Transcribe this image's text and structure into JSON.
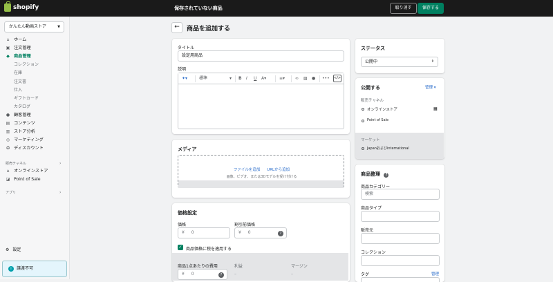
{
  "topbar": {
    "logo": "shopify",
    "title": "保存されていない商品",
    "discard": "取り消す",
    "save": "保存する"
  },
  "sidebar": {
    "store": "かんたん動画ストア",
    "items": [
      {
        "label": "ホーム",
        "icon": "home-icon",
        "glyph": "⌂"
      },
      {
        "label": "注文管理",
        "icon": "orders-icon",
        "glyph": "▣"
      },
      {
        "label": "商品管理",
        "icon": "tag-icon",
        "glyph": "◆",
        "active": true
      },
      {
        "label": "コレクション",
        "sub": true
      },
      {
        "label": "在庫",
        "sub": true
      },
      {
        "label": "注文書",
        "sub": true
      },
      {
        "label": "仕入",
        "sub": true
      },
      {
        "label": "ギフトカード",
        "sub": true
      },
      {
        "label": "カタログ",
        "sub": true
      },
      {
        "label": "顧客管理",
        "icon": "customers-icon",
        "glyph": "●"
      },
      {
        "label": "コンテンツ",
        "icon": "content-icon",
        "glyph": "▤"
      },
      {
        "label": "ストア分析",
        "icon": "analytics-icon",
        "glyph": "▥"
      },
      {
        "label": "マーケティング",
        "icon": "marketing-icon",
        "glyph": "◎"
      },
      {
        "label": "ディスカウント",
        "icon": "discount-icon",
        "glyph": "✪"
      }
    ],
    "channels_header": "販売チャネル",
    "channels": [
      {
        "label": "オンラインストア",
        "icon": "store-icon",
        "glyph": "⌂"
      },
      {
        "label": "Point of Sale",
        "icon": "pos-icon",
        "glyph": "◪"
      }
    ],
    "apps_header": "アプリ",
    "settings": "設定",
    "notice": "譲渡不可"
  },
  "page": {
    "title": "商品を追加する"
  },
  "product_card": {
    "title_label": "タイトル",
    "title_value": "設定用商品",
    "desc_label": "説明",
    "toolbar": {
      "format": "標準",
      "bold": "B",
      "italic": "I",
      "underline": "U",
      "color": "A",
      "align": "≡",
      "more": "•••",
      "code": "</>"
    }
  },
  "media_card": {
    "title": "メディア",
    "add_file": "ファイルを追加",
    "add_url": "URLから追加",
    "hint": "画像、ビデオ、または3Dモデルを受け付ける"
  },
  "pricing_card": {
    "title": "価格設定",
    "price_label": "価格",
    "price_value": "0",
    "currency": "¥",
    "compare_label": "割引前価格",
    "compare_value": "0",
    "tax_label": "商品価格に税を適用する",
    "cost_label": "商品1点あたりの費用",
    "cost_value": "0",
    "profit_label": "利益",
    "margin_label": "マージン"
  },
  "status_card": {
    "title": "ステータス",
    "value": "公開中"
  },
  "publish_card": {
    "title": "公開する",
    "manage": "管理 ▾",
    "channels_label": "販売チャネル",
    "channel1": "オンラインストア",
    "channel2": "Point of Sale",
    "markets_label": "マーケット",
    "market1": "Japanおよびinternational"
  },
  "org_card": {
    "title": "商品整理",
    "category_label": "商品カテゴリー",
    "category_placeholder": "検索",
    "type_label": "商品タイプ",
    "vendor_label": "販売元",
    "collection_label": "コレクション",
    "tags_label": "タグ",
    "tags_manage": "管理"
  }
}
